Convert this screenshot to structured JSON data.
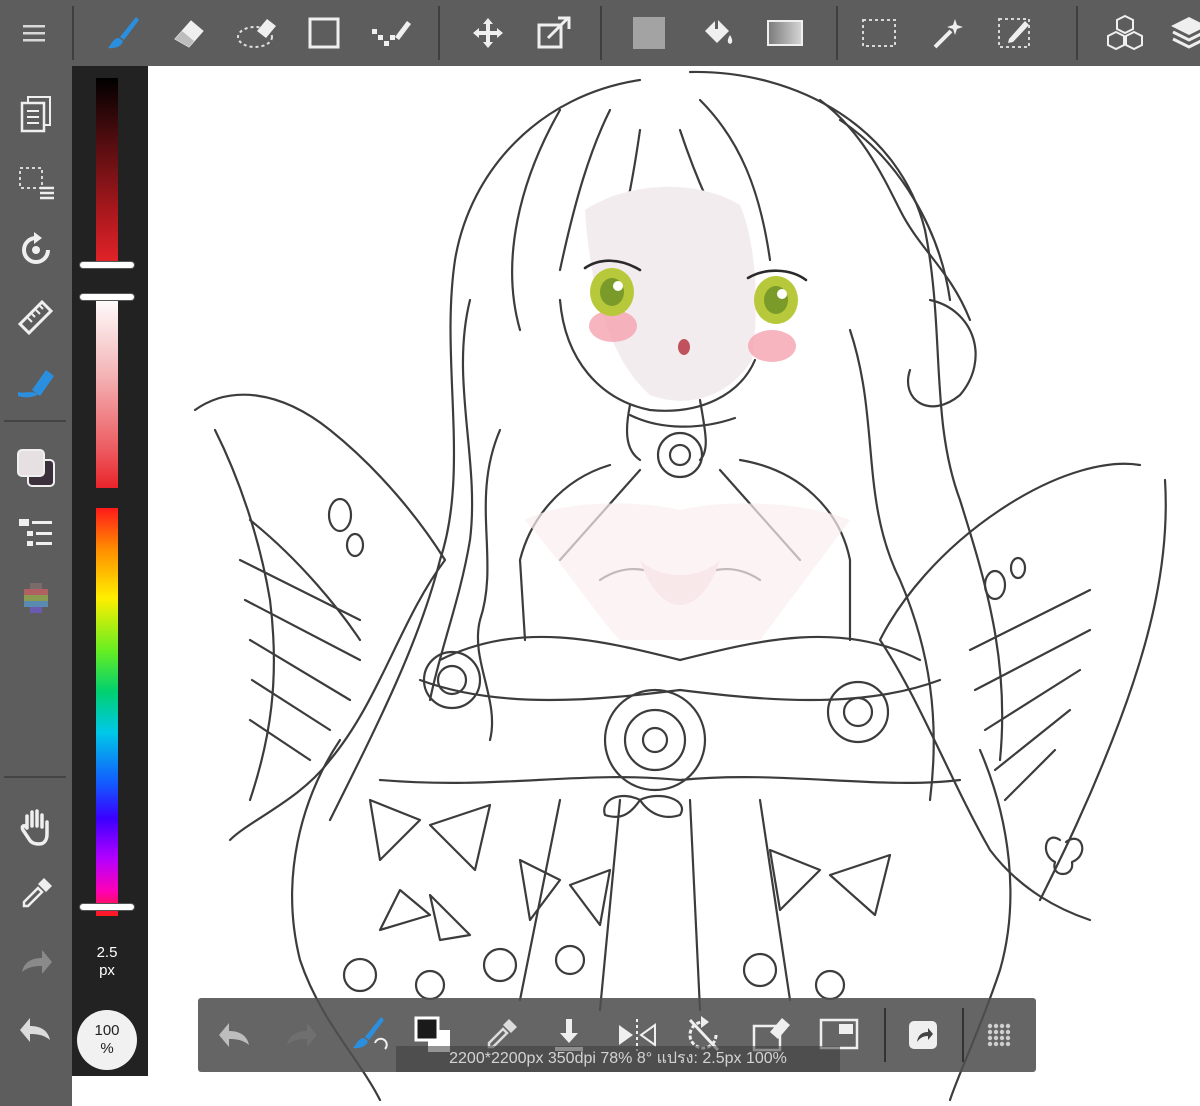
{
  "app": {
    "accent_color": "#2b8fdf",
    "toolbar_bg": "#5d5d5d",
    "panel_bg": "#222222"
  },
  "top_toolbar": {
    "tools": [
      "menu-icon",
      "brush-icon",
      "eraser-icon",
      "lasso-eraser-icon",
      "rectangle-icon",
      "dot-pen-icon",
      "move-icon",
      "transform-icon",
      "fill-color-icon",
      "bucket-icon",
      "gradient-icon",
      "marquee-select-icon",
      "magic-wand-icon",
      "select-pen-icon",
      "material-cubes-icon",
      "layers-icon"
    ],
    "active_tool": "brush-icon"
  },
  "left_toolbar": {
    "tools": [
      "pages-icon",
      "selection-menu-icon",
      "rotate-icon",
      "ruler-icon",
      "pen-tool-icon",
      "color-swatch-icon",
      "layer-list-icon",
      "palette-icon",
      "hand-icon",
      "eyedropper-icon",
      "redo-arrow-icon",
      "undo-arrow-icon"
    ]
  },
  "color_panel": {
    "brush_size_value": "2.5",
    "brush_size_unit": "px",
    "opacity_value": "100",
    "opacity_unit": "%",
    "current_color": "#e8242a"
  },
  "bottom_toolbar": {
    "tools": [
      "undo-icon",
      "redo-icon",
      "brush-blend-icon",
      "fg-bg-color-icon",
      "eyedropper-icon",
      "save-download-icon",
      "flip-icon",
      "rotate-reset-icon",
      "clear-layer-icon",
      "canvas-view-icon",
      "share-icon",
      "grid-menu-icon"
    ]
  },
  "status": {
    "text": "2200*2200px 350dpi 78% 8° แปรง: 2.5px 100%"
  }
}
